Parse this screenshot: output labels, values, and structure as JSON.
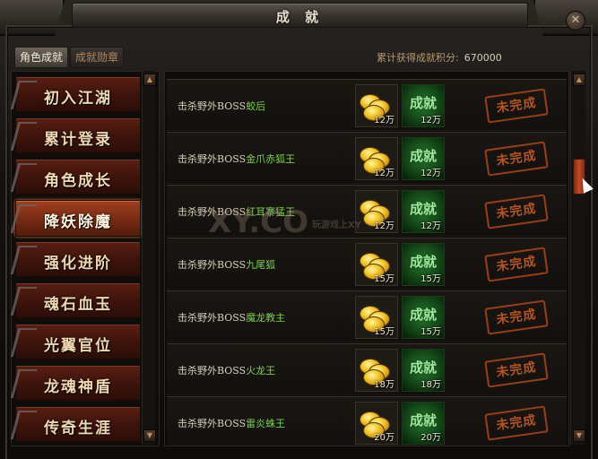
{
  "window": {
    "title": "成 就",
    "close_label": "✕"
  },
  "tabs": [
    {
      "label": "角色成就"
    },
    {
      "label": "成就勋章"
    }
  ],
  "points": {
    "label": "累计获得成就积分:",
    "value": "670000"
  },
  "categories": [
    {
      "label": "初入江湖"
    },
    {
      "label": "累计登录"
    },
    {
      "label": "角色成长"
    },
    {
      "label": "降妖除魔"
    },
    {
      "label": "强化进阶"
    },
    {
      "label": "魂石血玉"
    },
    {
      "label": "光翼官位"
    },
    {
      "label": "龙魂神盾"
    },
    {
      "label": "传奇生涯"
    }
  ],
  "achievements": [
    {
      "prefix": "击杀野外BOSS",
      "boss": "蛟后",
      "gold": "12万",
      "points_label": "成就",
      "points": "12万",
      "status": "未完成"
    },
    {
      "prefix": "击杀野外BOSS",
      "boss": "金爪赤狐王",
      "gold": "12万",
      "points_label": "成就",
      "points": "12万",
      "status": "未完成"
    },
    {
      "prefix": "击杀野外BOSS",
      "boss": "红耳寨猛王",
      "gold": "12万",
      "points_label": "成就",
      "points": "12万",
      "status": "未完成"
    },
    {
      "prefix": "击杀野外BOSS",
      "boss": "九尾狐",
      "gold": "15万",
      "points_label": "成就",
      "points": "15万",
      "status": "未完成"
    },
    {
      "prefix": "击杀野外BOSS",
      "boss": "魔龙教主",
      "gold": "15万",
      "points_label": "成就",
      "points": "15万",
      "status": "未完成"
    },
    {
      "prefix": "击杀野外BOSS",
      "boss": "火龙王",
      "gold": "18万",
      "points_label": "成就",
      "points": "18万",
      "status": "未完成"
    },
    {
      "prefix": "击杀野外BOSS",
      "boss": "雷炎蛛王",
      "gold": "20万",
      "points_label": "成就",
      "points": "20万",
      "status": "未完成"
    }
  ],
  "watermark": {
    "text": "XY.CO",
    "sub": "玩游戏上XY"
  },
  "scroll_up": "▲",
  "scroll_down": "▼",
  "colors": {
    "accent": "#c85a24",
    "boss_name": "#7ad050",
    "active_category": "#a04020"
  }
}
